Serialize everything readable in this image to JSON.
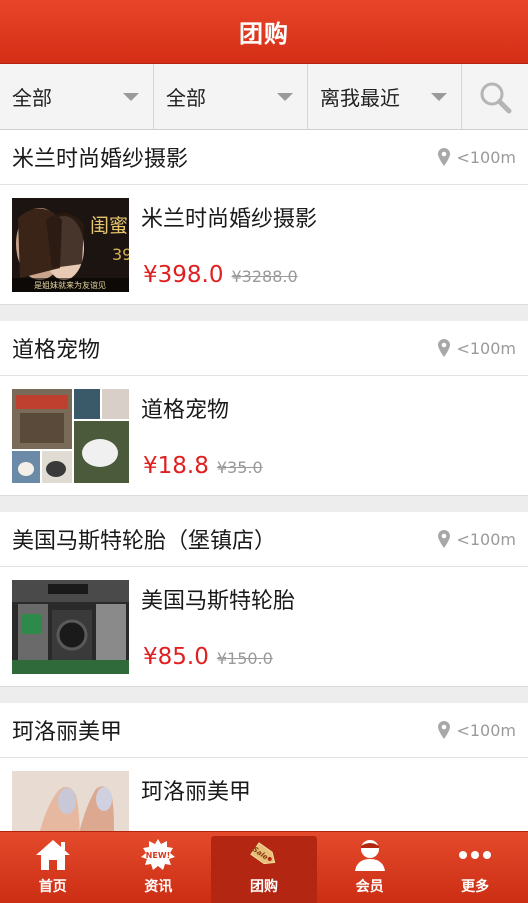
{
  "header": {
    "title": "团购"
  },
  "filters": [
    {
      "label": "全部"
    },
    {
      "label": "全部"
    },
    {
      "label": "离我最近"
    }
  ],
  "deals": [
    {
      "shop": "米兰时尚婚纱摄影",
      "distance": "<100m",
      "product": "米兰时尚婚纱摄影",
      "price": "¥398.0",
      "original": "¥3288.0",
      "thumb_text": "闺蜜",
      "thumb_subtext": "是姐妹就来为友谊见"
    },
    {
      "shop": "道格宠物",
      "distance": "<100m",
      "product": "道格宠物",
      "price": "¥18.8",
      "original": "¥35.0"
    },
    {
      "shop": "美国马斯特轮胎（堡镇店）",
      "distance": "<100m",
      "product": "美国马斯特轮胎",
      "price": "¥85.0",
      "original": "¥150.0"
    },
    {
      "shop": "珂洛丽美甲",
      "distance": "<100m",
      "product": "珂洛丽美甲",
      "price": "",
      "original": ""
    }
  ],
  "tabs": [
    {
      "label": "首页",
      "icon": "home-icon"
    },
    {
      "label": "资讯",
      "icon": "news-icon",
      "badge": "NEW!"
    },
    {
      "label": "团购",
      "icon": "sale-tag-icon",
      "badge": "Sale",
      "active": true
    },
    {
      "label": "会员",
      "icon": "member-icon"
    },
    {
      "label": "更多",
      "icon": "more-icon"
    }
  ],
  "colors": {
    "brand": "#d93a1f",
    "price": "#e02020"
  }
}
